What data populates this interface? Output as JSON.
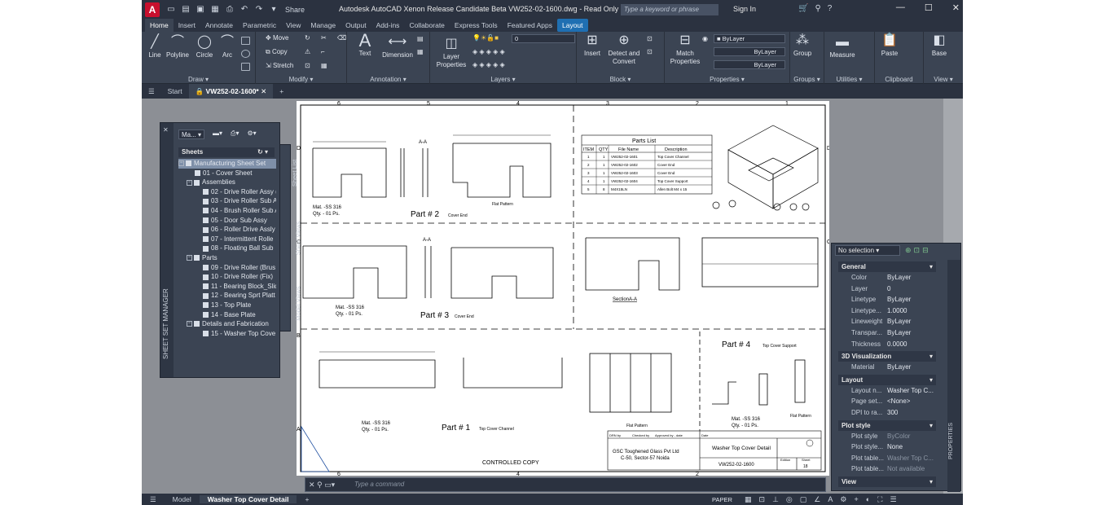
{
  "titlebar": {
    "app_logo": "A",
    "share": "Share",
    "title": "Autodesk AutoCAD Xenon Release Candidate Beta   VW252-02-1600.dwg - Read Only",
    "search_placeholder": "Type a keyword or phrase",
    "sign_in": "Sign In"
  },
  "ribbon_tabs": [
    "Home",
    "Insert",
    "Annotate",
    "Parametric",
    "View",
    "Manage",
    "Output",
    "Add-ins",
    "Collaborate",
    "Express Tools",
    "Featured Apps",
    "Layout"
  ],
  "ribbon": {
    "draw": {
      "title": "Draw ▾",
      "line": "Line",
      "polyline": "Polyline",
      "circle": "Circle",
      "arc": "Arc"
    },
    "modify": {
      "title": "Modify ▾",
      "move": "Move",
      "copy": "Copy",
      "stretch": "Stretch"
    },
    "annotation": {
      "title": "Annotation ▾",
      "text": "Text",
      "dimension": "Dimension"
    },
    "layers": {
      "title": "Layers ▾",
      "layer_props": "Layer Properties",
      "layer_value": "0"
    },
    "block": {
      "title": "Block ▾",
      "insert": "Insert",
      "detect": "Detect and Convert"
    },
    "properties": {
      "title": "Properties ▾",
      "match": "Match Properties",
      "color": "ByLayer",
      "linetype": "ByLayer",
      "lineweight": "ByLayer"
    },
    "groups": {
      "title": "Groups ▾",
      "group": "Group"
    },
    "utilities": {
      "title": "Utilities ▾",
      "measure": "Measure"
    },
    "clipboard": {
      "title": "Clipboard",
      "paste": "Paste"
    },
    "view": {
      "title": "View ▾",
      "base": "Base"
    }
  },
  "doc_tabs": {
    "start": "Start",
    "active": "VW252-02-1600*"
  },
  "ssm": {
    "title": "SHEET SET MANAGER",
    "dropdown": "Ma...",
    "sheets_label": "Sheets",
    "side_tabs": [
      "Sheet List",
      "Sheet Views",
      "Model Views"
    ],
    "tree": [
      {
        "label": "Manufacturing Sheet Set",
        "level": 0,
        "type": "set",
        "selected": true
      },
      {
        "label": "01 - Cover Sheet",
        "level": 1,
        "type": "sheet"
      },
      {
        "label": "Assemblies",
        "level": 1,
        "type": "group"
      },
      {
        "label": "02 - Drive Roller Assy (",
        "level": 2,
        "type": "sheet"
      },
      {
        "label": "03 - Drive Roller Sub A",
        "level": 2,
        "type": "sheet"
      },
      {
        "label": "04 - Brush Roller Sub A",
        "level": 2,
        "type": "sheet"
      },
      {
        "label": "05 - Door Sub Assy",
        "level": 2,
        "type": "sheet"
      },
      {
        "label": "06 - Roller Drive Assly",
        "level": 2,
        "type": "sheet"
      },
      {
        "label": "07 - Intermittent Rolle",
        "level": 2,
        "type": "sheet"
      },
      {
        "label": "08 - Floating Ball Sub",
        "level": 2,
        "type": "sheet"
      },
      {
        "label": "Parts",
        "level": 1,
        "type": "group"
      },
      {
        "label": "09 - Drive Roller (Brus",
        "level": 2,
        "type": "sheet"
      },
      {
        "label": "10 - Drive Roller (Fix)",
        "level": 2,
        "type": "sheet"
      },
      {
        "label": "11 - Bearing Block_Slid",
        "level": 2,
        "type": "sheet"
      },
      {
        "label": "12 - Bearing Sprt Platt",
        "level": 2,
        "type": "sheet"
      },
      {
        "label": "13 - Top Plate",
        "level": 2,
        "type": "sheet"
      },
      {
        "label": "14 - Base Plate",
        "level": 2,
        "type": "sheet"
      },
      {
        "label": "Details and Fabrication",
        "level": 1,
        "type": "group"
      },
      {
        "label": "15 - Washer Top Cove",
        "level": 2,
        "type": "sheet"
      }
    ]
  },
  "props": {
    "selection": "No selection",
    "side_label": "PROPERTIES",
    "sections": [
      {
        "name": "General",
        "rows": [
          [
            "Color",
            "ByLayer"
          ],
          [
            "Layer",
            "0"
          ],
          [
            "Linetype",
            "ByLayer"
          ],
          [
            "Linetype...",
            "1.0000"
          ],
          [
            "Lineweight",
            "ByLayer"
          ],
          [
            "Transpar...",
            "ByLayer"
          ],
          [
            "Thickness",
            "0.0000"
          ]
        ]
      },
      {
        "name": "3D Visualization",
        "rows": [
          [
            "Material",
            "ByLayer"
          ]
        ]
      },
      {
        "name": "Layout",
        "rows": [
          [
            "Layout n...",
            "Washer Top C..."
          ],
          [
            "Page set...",
            "<None>"
          ],
          [
            "DPI to ra...",
            "300"
          ]
        ]
      },
      {
        "name": "Plot style",
        "rows": [
          [
            "Plot style",
            "ByColor"
          ],
          [
            "Plot style...",
            "None"
          ],
          [
            "Plot table...",
            "Washer Top C..."
          ],
          [
            "Plot table...",
            "Not available"
          ]
        ]
      },
      {
        "name": "View",
        "rows": []
      }
    ]
  },
  "drawing": {
    "col_nums": [
      "6",
      "5",
      "4",
      "3",
      "2",
      "1"
    ],
    "row_letters": [
      "D",
      "C",
      "B",
      "A"
    ],
    "part2": "Part # 2",
    "part2_sub": "Cover End",
    "part3": "Part # 3",
    "part3_sub": "Cover End",
    "part1": "Part # 1",
    "part1_sub": "Top Cover Channel",
    "part4": "Part # 4",
    "part4_sub": "Top Cover Support",
    "mat_a": "Mat. -SS 316",
    "qty_a": "Qty. - 01 Ps.",
    "flat": "Flat Pattern",
    "section": "SectionA-A",
    "aa": "A-A",
    "controlled": "CONTROLLED COPY",
    "parts_list_title": "Parts List",
    "parts_list_headers": [
      "ITEM",
      "QTY",
      "File Name",
      "Description"
    ],
    "parts_list_rows": [
      [
        "1",
        "1",
        "VW252-02-1601",
        "Top Cover Channel"
      ],
      [
        "2",
        "1",
        "VW252-02-1602",
        "Cover End"
      ],
      [
        "3",
        "1",
        "VW252-02-1603",
        "Cover End"
      ],
      [
        "4",
        "1",
        "VW252-02-1604",
        "Top Cover Support"
      ],
      [
        "5",
        "8",
        "M4X15LN",
        "Allen Bolt M4 x 15"
      ]
    ],
    "tb_company": "GSC Toughened Glass Pvt Ltd",
    "tb_address": "C-50, Sector-57 Noida",
    "tb_title": "Washer Top Cover Detail",
    "tb_number": "VW252-02-1600",
    "tb_sheet": "18",
    "tb_drn": "DRN by",
    "tb_chk": "Checked by",
    "tb_app": "Approved by - date",
    "tb_date": "Date",
    "tb_edition": "Edition",
    "tb_sheet_label": "Sheet"
  },
  "command": {
    "placeholder": "Type a command"
  },
  "status": {
    "model": "Model",
    "layout": "Washer Top Cover Detail",
    "paper": "PAPER"
  }
}
